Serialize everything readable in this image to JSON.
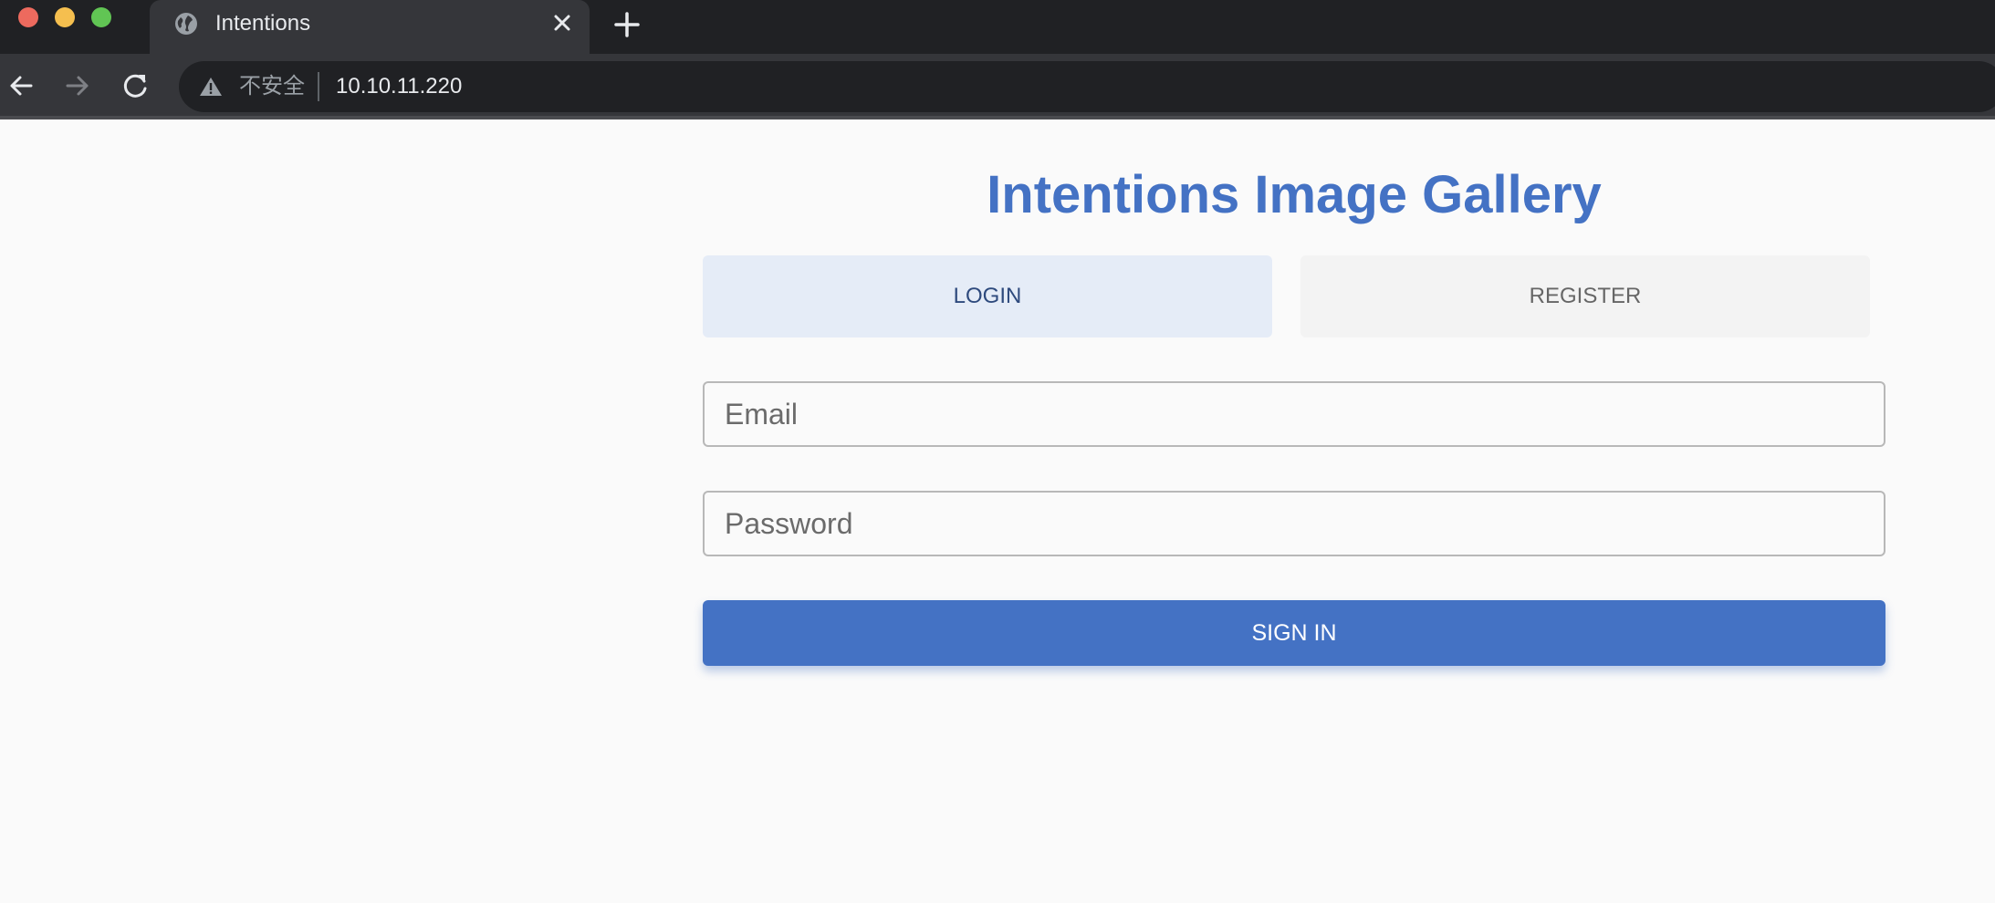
{
  "browser": {
    "tab_title": "Intentions",
    "security_label": "不安全",
    "url": "10.10.11.220",
    "icons": [
      "globe-icon",
      "close-icon",
      "plus-icon",
      "back-arrow-icon",
      "forward-arrow-icon",
      "reload-icon",
      "warning-icon"
    ]
  },
  "page": {
    "title": "Intentions Image Gallery",
    "tabs": [
      {
        "label": "LOGIN",
        "active": true
      },
      {
        "label": "REGISTER",
        "active": false
      }
    ],
    "email_placeholder": "Email",
    "password_placeholder": "Password",
    "signin_label": "SIGN IN"
  },
  "colors": {
    "accent": "#4472c4",
    "active_tab_bg": "#e5ecf7",
    "inactive_tab_bg": "#f3f3f3"
  }
}
